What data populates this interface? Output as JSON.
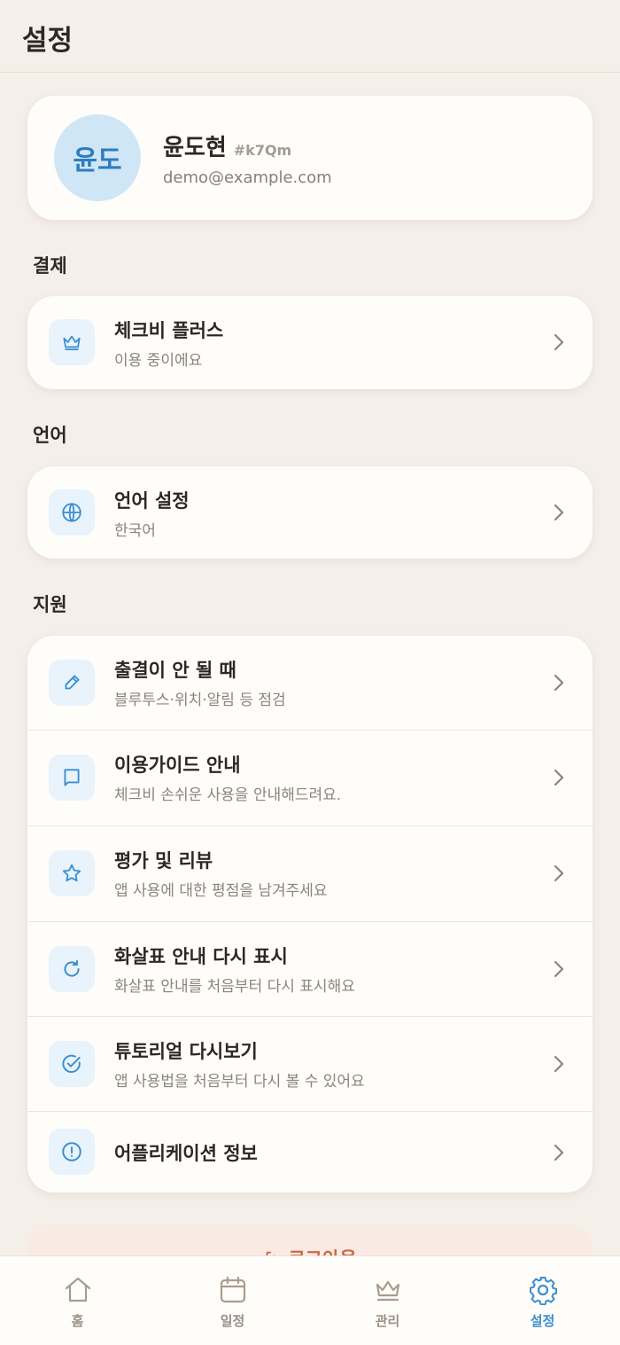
{
  "header": {
    "title": "설정"
  },
  "profile": {
    "avatar_text": "윤도",
    "name": "윤도현",
    "tag": "#k7Qm",
    "email": "demo@example.com"
  },
  "sections": {
    "payment": {
      "label": "결제",
      "items": [
        {
          "title": "체크비 플러스",
          "subtitle": "이용 중이에요",
          "icon": "crown-icon"
        }
      ]
    },
    "language": {
      "label": "언어",
      "items": [
        {
          "title": "언어 설정",
          "subtitle": "한국어",
          "icon": "globe-icon"
        }
      ]
    },
    "support": {
      "label": "지원",
      "items": [
        {
          "title": "출결이 안 될 때",
          "subtitle": "블루투스·위치·알림 등 점검",
          "icon": "pencil-icon"
        },
        {
          "title": "이용가이드 안내",
          "subtitle": "체크비 손쉬운 사용을 안내해드려요.",
          "icon": "book-icon"
        },
        {
          "title": "평가 및 리뷰",
          "subtitle": "앱 사용에 대한 평점을 남겨주세요",
          "icon": "star-icon"
        },
        {
          "title": "화살표 안내 다시 표시",
          "subtitle": "화살표 안내를 처음부터 다시 표시해요",
          "icon": "refresh-icon"
        },
        {
          "title": "튜토리얼 다시보기",
          "subtitle": "앱 사용법을 처음부터 다시 볼 수 있어요",
          "icon": "check-circle-icon"
        },
        {
          "title": "어플리케이션 정보",
          "subtitle": "",
          "icon": "info-icon"
        }
      ]
    }
  },
  "logout": {
    "label": "로그아웃"
  },
  "tabbar": {
    "tabs": [
      {
        "label": "홈",
        "icon": "home-icon"
      },
      {
        "label": "일정",
        "icon": "calendar-icon"
      },
      {
        "label": "관리",
        "icon": "crown-icon"
      },
      {
        "label": "설정",
        "icon": "gear-icon",
        "active": true
      }
    ]
  },
  "colors": {
    "background": "#f5efea",
    "card": "#fefdf9",
    "accent": "#3a8ed0",
    "icon_bg": "#e8f3fc",
    "logout_text": "#d0674a"
  }
}
